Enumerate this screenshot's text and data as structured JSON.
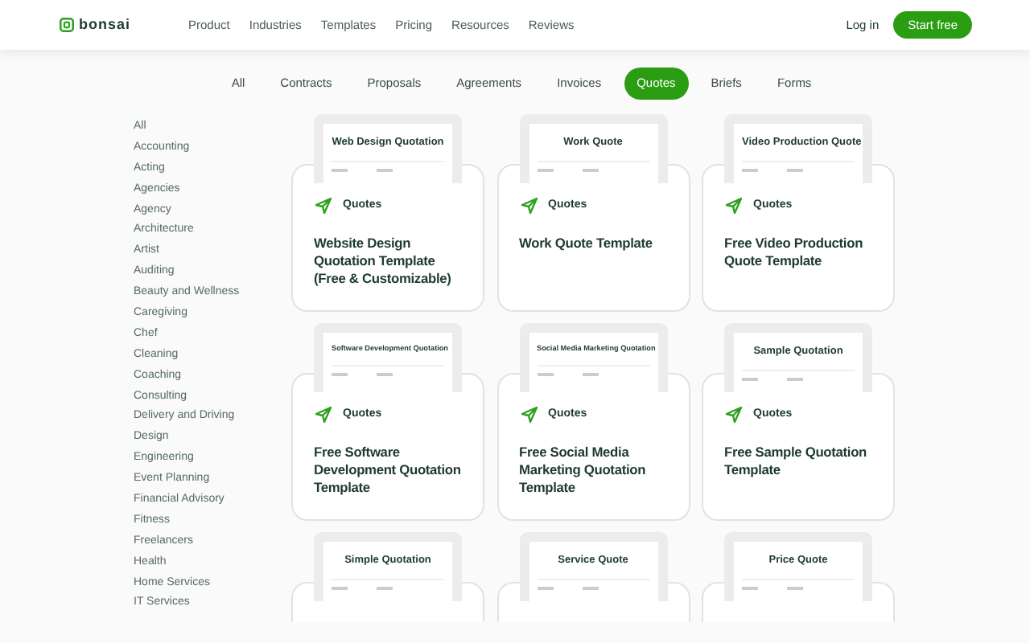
{
  "header": {
    "logo": "bonsai",
    "nav": [
      "Product",
      "Industries",
      "Templates",
      "Pricing",
      "Resources",
      "Reviews"
    ],
    "login": "Log in",
    "cta": "Start free"
  },
  "tabs": [
    {
      "label": "All",
      "selected": false
    },
    {
      "label": "Contracts",
      "selected": false
    },
    {
      "label": "Proposals",
      "selected": false
    },
    {
      "label": "Agreements",
      "selected": false
    },
    {
      "label": "Invoices",
      "selected": false
    },
    {
      "label": "Quotes",
      "selected": true
    },
    {
      "label": "Briefs",
      "selected": false
    },
    {
      "label": "Forms",
      "selected": false
    }
  ],
  "sidebar": {
    "items": [
      "All",
      "Accounting",
      "Acting",
      "Agencies",
      "Agency",
      "Architecture",
      "Artist",
      "Auditing",
      "Beauty and Wellness",
      "Caregiving",
      "Chef",
      "Cleaning",
      "Coaching",
      "Consulting",
      "Delivery and Driving",
      "Design",
      "Engineering",
      "Event Planning",
      "Financial Advisory",
      "Fitness",
      "Freelancers",
      "Health",
      "Home Services",
      "IT Services"
    ]
  },
  "cards": [
    {
      "preview_title": "Web Design Quotation",
      "category": "Quotes",
      "title": "Website Design Quotation Template (Free & Customizable)"
    },
    {
      "preview_title": "Work Quote",
      "category": "Quotes",
      "title": "Work Quote Template"
    },
    {
      "preview_title": "Video Production Quote",
      "category": "Quotes",
      "title": "Free Video Production Quote Template"
    },
    {
      "preview_title": "Software Development Quotation",
      "category": "Quotes",
      "title": "Free Software Development Quotation Template"
    },
    {
      "preview_title": "Social Media Marketing Quotation",
      "category": "Quotes",
      "title": "Free Social Media Marketing Quotation Template"
    },
    {
      "preview_title": "Sample Quotation",
      "category": "Quotes",
      "title": "Free Sample Quotation Template"
    },
    {
      "preview_title": "Simple Quotation"
    },
    {
      "preview_title": "Service Quote"
    },
    {
      "preview_title": "Price Quote"
    }
  ]
}
